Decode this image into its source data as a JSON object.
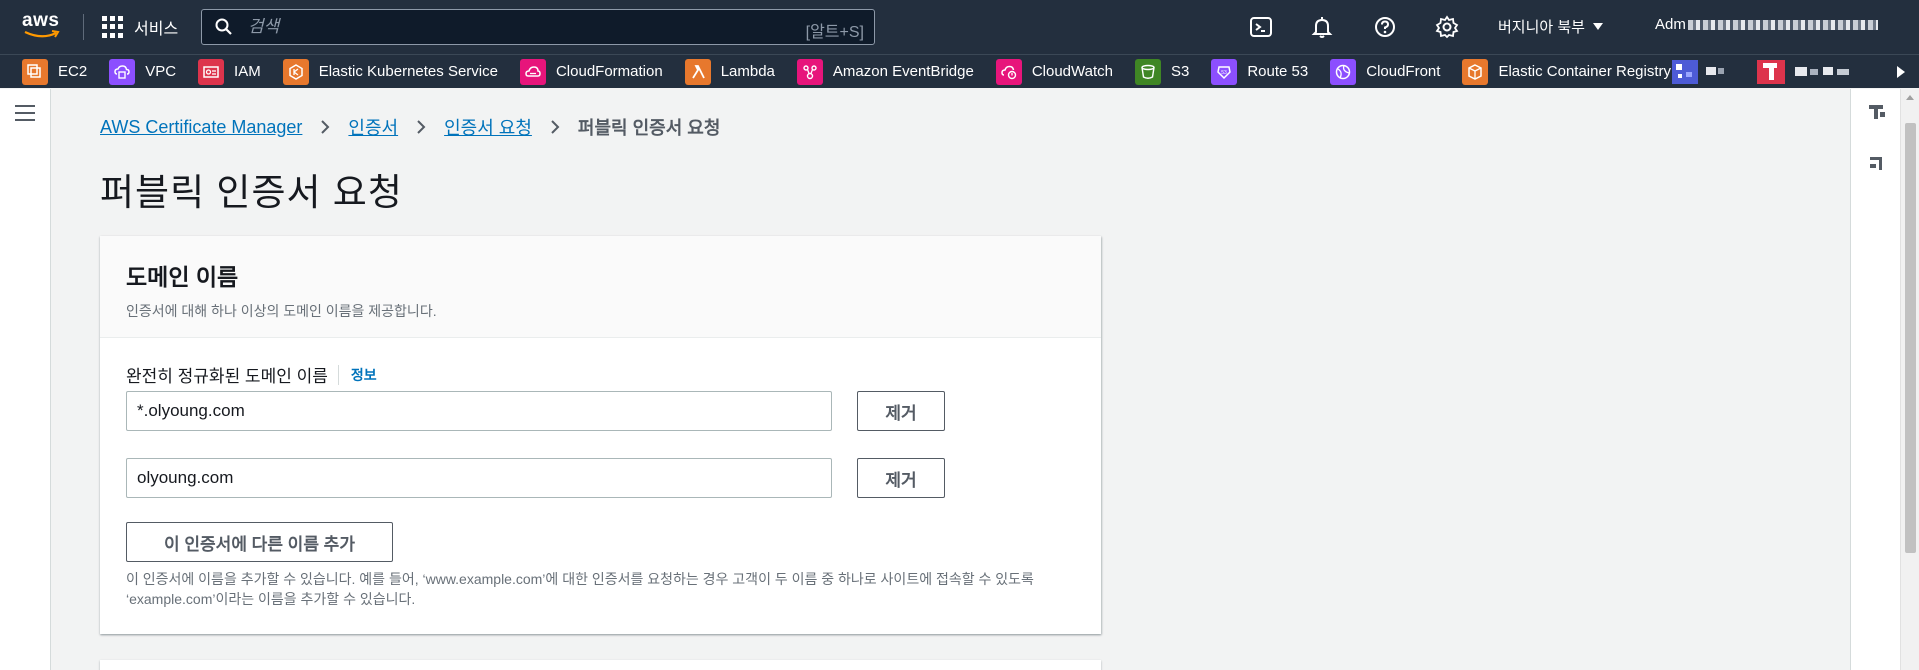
{
  "topnav": {
    "logo": "aws",
    "services_label": "서비스",
    "search_placeholder": "검색",
    "search_shortcut": "[알트+S]",
    "region_label": "버지니아 북부",
    "account_label": "Adm",
    "icons": [
      "cloudshell-icon",
      "bell-icon",
      "help-icon",
      "gear-icon"
    ]
  },
  "favorites": [
    {
      "label": "EC2",
      "color": "#e7782d"
    },
    {
      "label": "VPC",
      "color": "#8c4fff"
    },
    {
      "label": "IAM",
      "color": "#dd344c"
    },
    {
      "label": "Elastic Kubernetes Service",
      "color": "#e7782d"
    },
    {
      "label": "CloudFormation",
      "color": "#e7157b"
    },
    {
      "label": "Lambda",
      "color": "#e7782d"
    },
    {
      "label": "Amazon EventBridge",
      "color": "#e7157b"
    },
    {
      "label": "CloudWatch",
      "color": "#e7157b"
    },
    {
      "label": "S3",
      "color": "#3f8624"
    },
    {
      "label": "Route 53",
      "color": "#8c4fff"
    },
    {
      "label": "CloudFront",
      "color": "#8c4fff"
    },
    {
      "label": "Elastic Container Registry",
      "color": "#e7782d"
    }
  ],
  "breadcrumb": {
    "item1": "AWS Certificate Manager",
    "item2": "인증서",
    "item3": "인증서 요청",
    "current": "퍼블릭 인증서 요청"
  },
  "page": {
    "title": "퍼블릭 인증서 요청"
  },
  "domain_panel": {
    "title": "도메인 이름",
    "description": "인증서에 대해 하나 이상의 도메인 이름을 제공합니다.",
    "field_label": "완전히 정규화된 도메인 이름",
    "info_link": "정보",
    "domains": [
      {
        "value": "*.olyoung.com",
        "remove_label": "제거"
      },
      {
        "value": "olyoung.com",
        "remove_label": "제거"
      }
    ],
    "add_button": "이 인증서에 다른 이름 추가",
    "help_text": "이 인증서에 이름을 추가할 수 있습니다. 예를 들어, ‘www.example.com’에 대한 인증서를 요청하는 경우 고객이 두 이름 중 하나로 사이트에 접속할 수 있도록 ‘example.com’이라는 이름을 추가할 수 있습니다."
  },
  "colors": {
    "nav_bg": "#232f3e",
    "link": "#0073bb",
    "page_bg": "#f2f3f3"
  }
}
